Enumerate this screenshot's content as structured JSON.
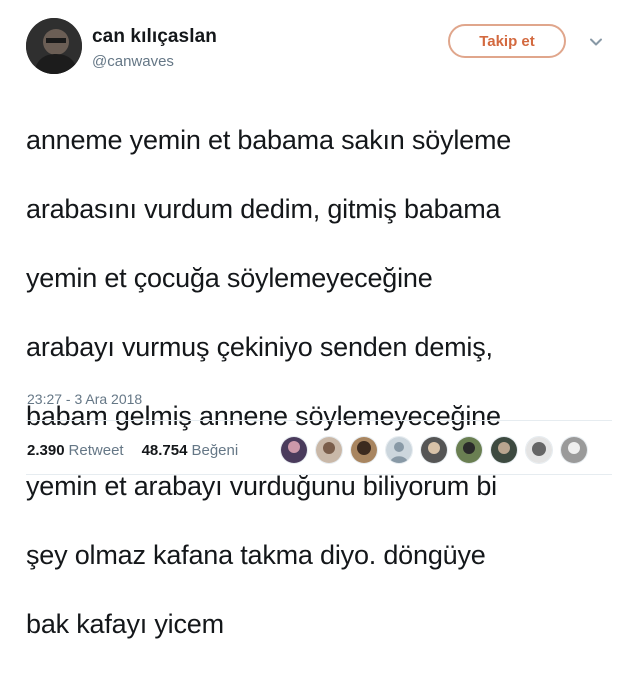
{
  "user": {
    "name": "can kılıçaslan",
    "handle": "@canwaves"
  },
  "actions": {
    "follow_label": "Takip et"
  },
  "tweet": {
    "text_lines": [
      "anneme yemin et babama sakın söyleme",
      "arabasını vurdum dedim, gitmiş babama",
      "yemin et çocuğa söylemeyeceğine",
      "arabayı vurmuş çekiniyo senden demiş,",
      "babam gelmiş annene söylemeyeceğine",
      "yemin et arabayı vurduğunu biliyorum bi",
      "şey olmaz kafana takma diyo. döngüye",
      "bak kafayı yicem"
    ],
    "timestamp": "23:27 - 3 Ara 2018"
  },
  "stats": {
    "retweets": "2.390",
    "retweets_label": "Retweet",
    "likes": "48.754",
    "likes_label": "Beğeni"
  },
  "colors": {
    "follow_accent": "#d3693f",
    "secondary_text": "#657786"
  }
}
